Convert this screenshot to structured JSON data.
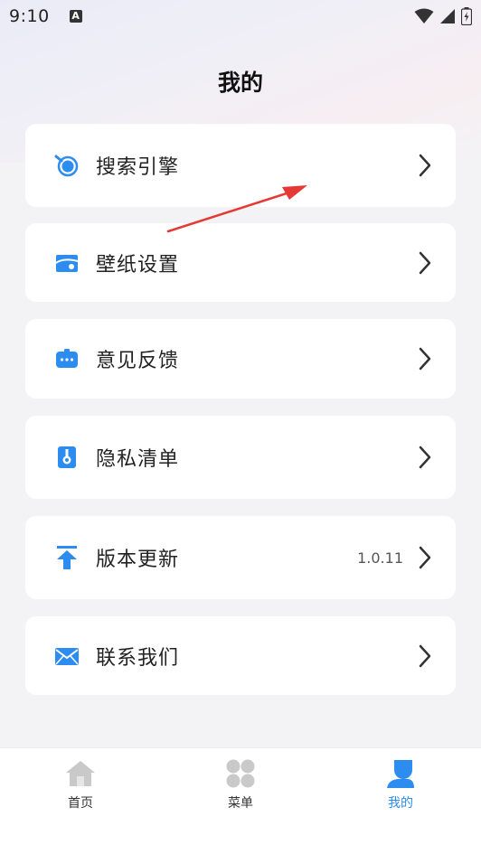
{
  "status_bar": {
    "time": "9:10",
    "notification_icon": "A"
  },
  "page": {
    "title": "我的"
  },
  "menu": [
    {
      "label": "搜索引擎",
      "value": "",
      "icon": "search-engine-icon"
    },
    {
      "label": "壁纸设置",
      "value": "",
      "icon": "wallpaper-icon"
    },
    {
      "label": "意见反馈",
      "value": "",
      "icon": "feedback-icon"
    },
    {
      "label": "隐私清单",
      "value": "",
      "icon": "privacy-icon"
    },
    {
      "label": "版本更新",
      "value": "1.0.11",
      "icon": "update-icon"
    },
    {
      "label": "联系我们",
      "value": "",
      "icon": "mail-icon"
    }
  ],
  "tabs": [
    {
      "label": "首页",
      "icon": "home-icon",
      "active": false
    },
    {
      "label": "菜单",
      "icon": "grid-icon",
      "active": false
    },
    {
      "label": "我的",
      "icon": "user-icon",
      "active": true
    }
  ],
  "colors": {
    "accent": "#2c8cf0",
    "annotation": "#e53935",
    "background": "#f3f3f5"
  }
}
